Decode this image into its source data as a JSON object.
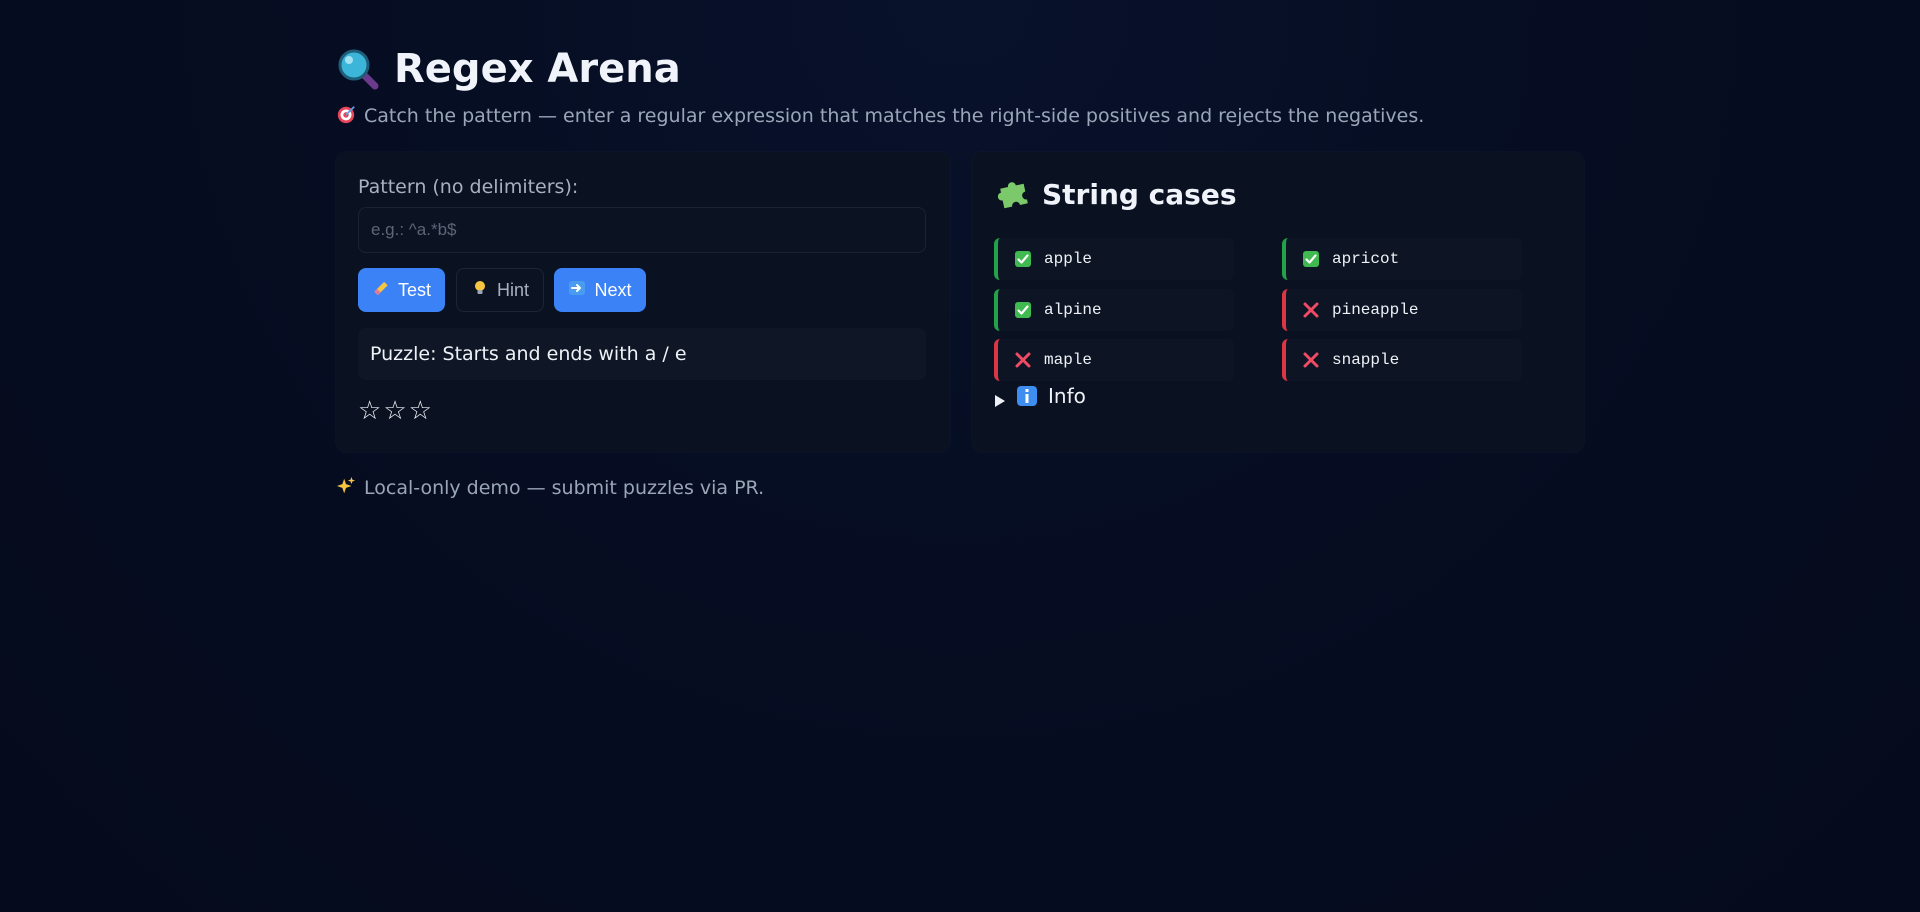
{
  "header": {
    "title": "Regex Arena",
    "title_icon": "magnifier-icon",
    "subtitle": "Catch the pattern — enter a regular expression that matches the right-side positives and rejects the negatives.",
    "subtitle_icon": "target-icon"
  },
  "editor": {
    "label": "Pattern (no delimiters):",
    "value": "",
    "placeholder": "e.g.: ^a.*b$",
    "buttons": {
      "test": "Test",
      "hint": "Hint",
      "next": "Next"
    },
    "puzzle": "Puzzle: Starts and ends with a / e",
    "stars": [
      "☆",
      "☆",
      "☆"
    ]
  },
  "cases": {
    "title": "String cases",
    "title_icon": "puzzle-piece-icon",
    "items": [
      {
        "text": "apple",
        "kind": "positive",
        "icon": "check-icon"
      },
      {
        "text": "apricot",
        "kind": "positive",
        "icon": "check-icon"
      },
      {
        "text": "alpine",
        "kind": "positive",
        "icon": "check-icon"
      },
      {
        "text": "pineapple",
        "kind": "negative",
        "icon": "cross-icon"
      },
      {
        "text": "maple",
        "kind": "negative",
        "icon": "cross-icon"
      },
      {
        "text": "snapple",
        "kind": "negative",
        "icon": "cross-icon"
      }
    ],
    "info_label": "Info"
  },
  "footer": {
    "text": "Local-only demo — submit puzzles via PR.",
    "icon": "sparkles-icon"
  },
  "colors": {
    "accent": "#3b82f6",
    "positive": "#22a34a",
    "negative": "#dc3545",
    "background": "#060d22"
  }
}
